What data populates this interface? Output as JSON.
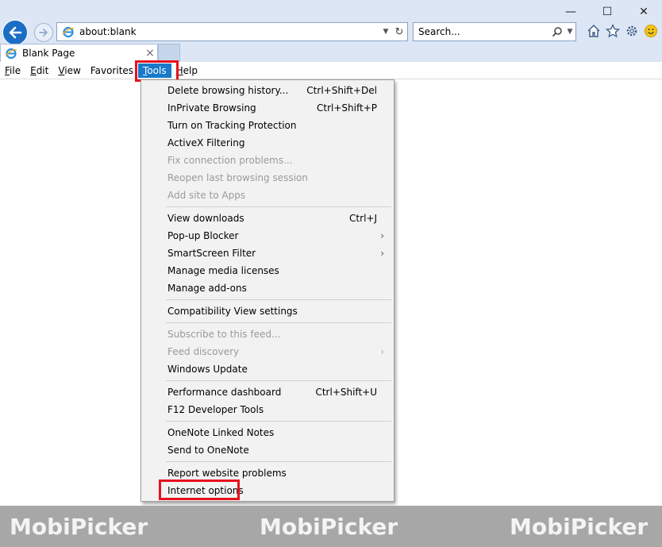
{
  "window": {
    "minimize": "—",
    "maximize": "☐",
    "close": "✕"
  },
  "address": {
    "url": "about:blank"
  },
  "search": {
    "placeholder": "Search..."
  },
  "tab": {
    "title": "Blank Page",
    "close": "×"
  },
  "menubar": {
    "items": [
      {
        "first": "F",
        "rest": "ile"
      },
      {
        "first": "E",
        "rest": "dit"
      },
      {
        "first": "V",
        "rest": "iew"
      },
      {
        "first": "",
        "rest": "Favorites"
      },
      {
        "first": "T",
        "rest": "ools"
      },
      {
        "first": "H",
        "rest": "elp"
      }
    ]
  },
  "tools_menu": {
    "group1": [
      {
        "label": "Delete browsing history...",
        "shortcut": "Ctrl+Shift+Del"
      },
      {
        "label": "InPrivate Browsing",
        "shortcut": "Ctrl+Shift+P"
      },
      {
        "label": "Turn on Tracking Protection",
        "shortcut": ""
      },
      {
        "label": "ActiveX Filtering",
        "shortcut": ""
      },
      {
        "label": "Fix connection problems...",
        "shortcut": ""
      },
      {
        "label": "Reopen last browsing session",
        "shortcut": ""
      },
      {
        "label": "Add site to Apps",
        "shortcut": ""
      }
    ],
    "group2": [
      {
        "label": "View downloads",
        "shortcut": "Ctrl+J"
      },
      {
        "label": "Pop-up Blocker",
        "arrow": "›"
      },
      {
        "label": "SmartScreen Filter",
        "arrow": "›"
      },
      {
        "label": "Manage media licenses"
      },
      {
        "label": "Manage add-ons"
      }
    ],
    "group3": [
      {
        "label": "Compatibility View settings"
      }
    ],
    "group4": [
      {
        "label": "Subscribe to this feed..."
      },
      {
        "label": "Feed discovery",
        "arrow": "›"
      },
      {
        "label": "Windows Update"
      }
    ],
    "group5": [
      {
        "label": "Performance dashboard",
        "shortcut": "Ctrl+Shift+U"
      },
      {
        "label": "F12 Developer Tools"
      }
    ],
    "group6": [
      {
        "label": "OneNote Linked Notes"
      },
      {
        "label": "Send to OneNote"
      }
    ],
    "group7": [
      {
        "label": "Report website problems"
      },
      {
        "label": "Internet options"
      }
    ]
  },
  "watermark": {
    "mobi": "Mobi",
    "picker": "Picker"
  },
  "colors": {
    "chrome_bg": "#dce6f4",
    "accent": "#1979ca",
    "highlight_box": "#e8111d",
    "menu_bg": "#f2f2f2",
    "disabled_text": "#9a9a9a"
  }
}
